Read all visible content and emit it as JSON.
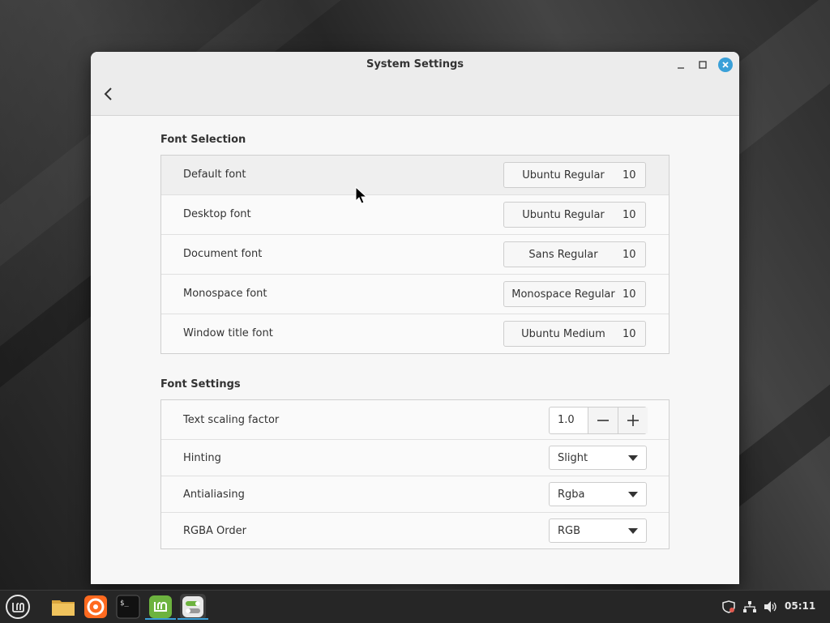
{
  "window": {
    "title": "System Settings"
  },
  "font_selection": {
    "heading": "Font Selection",
    "rows": [
      {
        "label": "Default font",
        "font": "Ubuntu Regular",
        "size": "10"
      },
      {
        "label": "Desktop font",
        "font": "Ubuntu Regular",
        "size": "10"
      },
      {
        "label": "Document font",
        "font": "Sans Regular",
        "size": "10"
      },
      {
        "label": "Monospace font",
        "font": "Monospace Regular",
        "size": "10"
      },
      {
        "label": "Window title font",
        "font": "Ubuntu Medium",
        "size": "10"
      }
    ]
  },
  "font_settings": {
    "heading": "Font Settings",
    "text_scaling": {
      "label": "Text scaling factor",
      "value": "1.0"
    },
    "hinting": {
      "label": "Hinting",
      "value": "Slight"
    },
    "antialiasing": {
      "label": "Antialiasing",
      "value": "Rgba"
    },
    "rgba_order": {
      "label": "RGBA Order",
      "value": "RGB"
    }
  },
  "taskbar": {
    "apps": [
      "mint-menu-icon",
      "files-icon",
      "firefox-icon",
      "terminal-icon",
      "mintupdate-icon",
      "system-settings-icon"
    ],
    "clock": "05:11"
  },
  "colors": {
    "accent": "#3aa0d8",
    "mint_green": "#6db33f",
    "firefox_orange": "#ff6a1f"
  }
}
